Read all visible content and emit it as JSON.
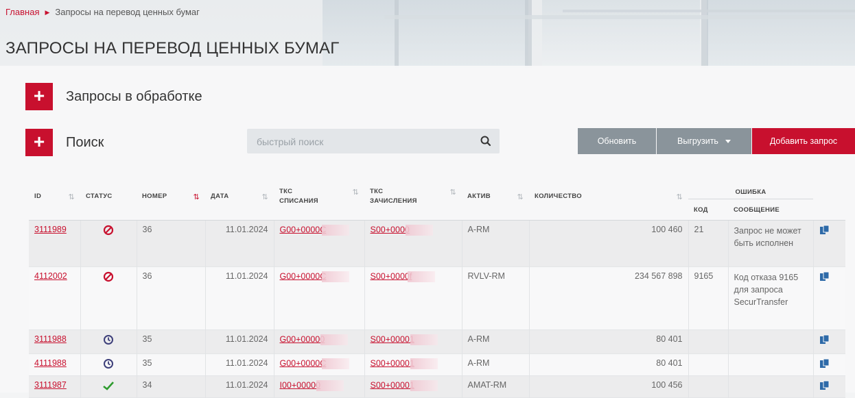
{
  "breadcrumb": {
    "home": "Главная",
    "current": "Запросы на перевод ценных бумаг"
  },
  "page_title": "ЗАПРОСЫ НА ПЕРЕВОД ЦЕННЫХ БУМАГ",
  "sections": {
    "processing": "Запросы в обработке",
    "search": "Поиск"
  },
  "search": {
    "placeholder": "быстрый поиск",
    "value": ""
  },
  "buttons": {
    "refresh": "Обновить",
    "export": "Выгрузить",
    "add": "Добавить запрос"
  },
  "colors": {
    "accent": "#c8102e",
    "secondary_button": "#8a949b",
    "status_ok": "#2e9b2e",
    "status_pending": "#3d3f7a"
  },
  "table": {
    "headers": {
      "id": "ID",
      "status": "СТАТУС",
      "number": "НОМЕР",
      "date": "ДАТА",
      "tks_debit_1": "ТКС",
      "tks_debit_2": "СПИСАНИЯ",
      "tks_credit_1": "ТКС",
      "tks_credit_2": "ЗАЧИСЛЕНИЯ",
      "asset": "АКТИВ",
      "quantity": "КОЛИЧЕСТВО",
      "error_group": "ОШИБКА",
      "error_code": "КОД",
      "error_message": "СООБЩЕНИЕ"
    },
    "rows": [
      {
        "id": "3111989",
        "status": "rejected-icon",
        "number": "36",
        "date": "11.01.2024",
        "tks_debit": "G00+0000C",
        "tks_credit": "S00+0000",
        "asset": "A-RM",
        "quantity": "100 460",
        "code": "21",
        "message": "Запрос не может быть исполнен"
      },
      {
        "id": "4112002",
        "status": "rejected-icon",
        "number": "36",
        "date": "11.01.2024",
        "tks_debit": "G00+0000C",
        "tks_credit": "S00+0000f",
        "asset": "RVLV-RM",
        "quantity": "234 567 898",
        "code": "9165",
        "message": "Код отказа 9165 для запроса SecurTransfer"
      },
      {
        "id": "3111988",
        "status": "pending-icon",
        "number": "35",
        "date": "11.01.2024",
        "tks_debit": "G00+00000",
        "tks_credit": "S00+00001",
        "asset": "A-RM",
        "quantity": "80 401",
        "code": "",
        "message": ""
      },
      {
        "id": "4111988",
        "status": "pending-icon",
        "number": "35",
        "date": "11.01.2024",
        "tks_debit": "G00+0000C",
        "tks_credit": "S00+00001",
        "asset": "A-RM",
        "quantity": "80 401",
        "code": "",
        "message": ""
      },
      {
        "id": "3111987",
        "status": "done-icon",
        "number": "34",
        "date": "11.01.2024",
        "tks_debit": "I00+00000",
        "tks_credit": "S00+00001",
        "asset": "AMAT-RM",
        "quantity": "100 456",
        "code": "",
        "message": ""
      }
    ]
  }
}
